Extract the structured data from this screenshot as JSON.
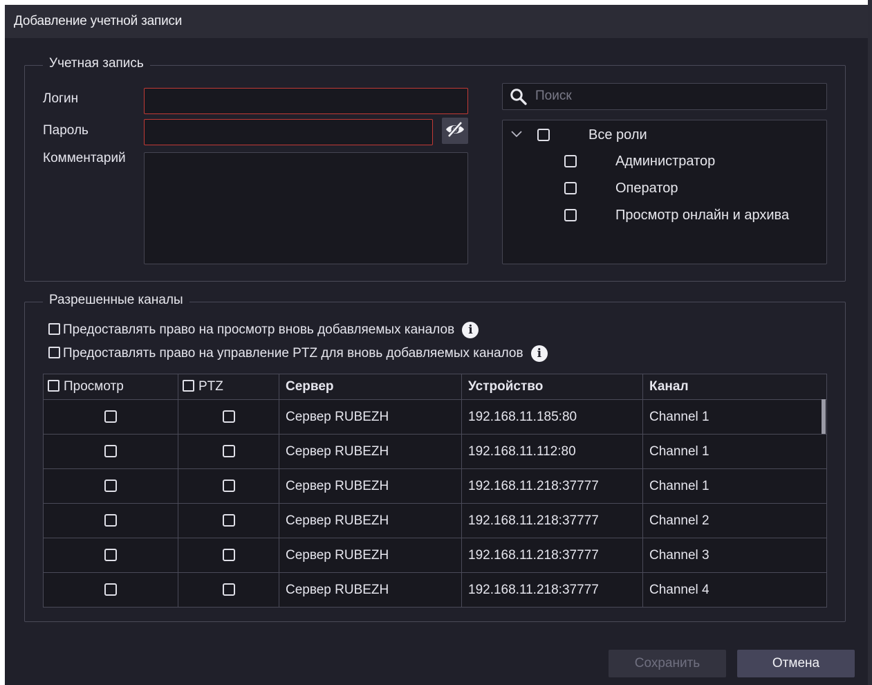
{
  "dialog": {
    "title": "Добавление учетной записи"
  },
  "account": {
    "legend": "Учетная запись",
    "login_label": "Логин",
    "login_value": "",
    "password_label": "Пароль",
    "password_value": "",
    "comment_label": "Комментарий",
    "comment_value": "",
    "toggle_password_icon": "eye-slash-icon"
  },
  "roles": {
    "search_placeholder": "Поиск",
    "all_roles": "Все роли",
    "items": [
      {
        "label": "Администратор",
        "checked": false
      },
      {
        "label": "Оператор",
        "checked": false
      },
      {
        "label": "Просмотр онлайн и архива",
        "checked": false
      }
    ]
  },
  "channels": {
    "legend": "Разрешенные каналы",
    "option_view": "Предоставлять право на просмотр вновь добавляемых каналов",
    "option_ptz": "Предоставлять право на управление PTZ для вновь добавляемых каналов",
    "columns": {
      "view": "Просмотр",
      "ptz": "PTZ",
      "server": "Сервер",
      "device": "Устройство",
      "channel": "Канал"
    },
    "rows": [
      {
        "server": "Сервер RUBEZH",
        "device": "192.168.11.185:80",
        "channel": "Channel 1"
      },
      {
        "server": "Сервер RUBEZH",
        "device": "192.168.11.112:80",
        "channel": "Channel 1"
      },
      {
        "server": "Сервер RUBEZH",
        "device": "192.168.11.218:37777",
        "channel": "Channel 1"
      },
      {
        "server": "Сервер RUBEZH",
        "device": "192.168.11.218:37777",
        "channel": "Channel 2"
      },
      {
        "server": "Сервер RUBEZH",
        "device": "192.168.11.218:37777",
        "channel": "Channel 3"
      },
      {
        "server": "Сервер RUBEZH",
        "device": "192.168.11.218:37777",
        "channel": "Channel 4"
      }
    ]
  },
  "footer": {
    "save_label": "Сохранить",
    "cancel_label": "Отмена"
  },
  "colors": {
    "background": "#20202a",
    "error_border": "#c23a36",
    "disabled_text": "#707080"
  }
}
